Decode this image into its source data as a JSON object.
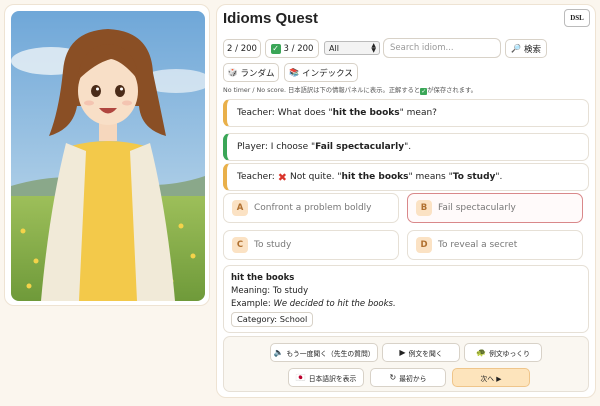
{
  "app": {
    "title": "Idioms Quest",
    "badge": "DSL"
  },
  "toolbar": {
    "progress": "2 / 200",
    "known": "3 / 200",
    "filter": {
      "selected": "All"
    },
    "search": {
      "placeholder": "Search idiom...",
      "value": ""
    },
    "search_button": "検索",
    "random_button": "ランダム",
    "index_button": "インデックス"
  },
  "hint": {
    "before": "No timer / No score. 日本語訳は下の情報パネルに表示。正解すると",
    "after": "が保存されます。"
  },
  "dialogue": {
    "q_prefix": "Teacher: What does \"",
    "q_term": "hit the books",
    "q_suffix": "\" mean?",
    "p_prefix": "Player: I choose \"",
    "p_choice": "Fail spectacularly",
    "p_suffix": "\".",
    "f_prefix": "Teacher:",
    "f_text": "Not quite. \"",
    "f_term": "hit the books",
    "f_mid": "\" means \"",
    "f_answer": "To study",
    "f_suffix": "\"."
  },
  "options": [
    {
      "letter": "A",
      "text": "Confront a problem boldly"
    },
    {
      "letter": "B",
      "text": "Fail spectacularly"
    },
    {
      "letter": "C",
      "text": "To study"
    },
    {
      "letter": "D",
      "text": "To reveal a secret"
    }
  ],
  "detail": {
    "term": "hit the books",
    "meaning_label": "Meaning:",
    "meaning": "To study",
    "example_label": "Example:",
    "example": "We decided to hit the books.",
    "category_label": "Category:",
    "category": "School"
  },
  "controls": {
    "replay": "もう一度聞く（先生の質問）",
    "hear_example": "例文を聞く",
    "slow_example": "例文ゆっくり",
    "show_japanese": "日本語訳を表示",
    "restart": "最初から",
    "next": "次へ ▶"
  },
  "colors": {
    "accent_teacher": "#e9b04a",
    "accent_player": "#3aa657",
    "wrong": "#d9342b",
    "selected_border": "#d9888a",
    "next_button": "#fde4bc"
  }
}
